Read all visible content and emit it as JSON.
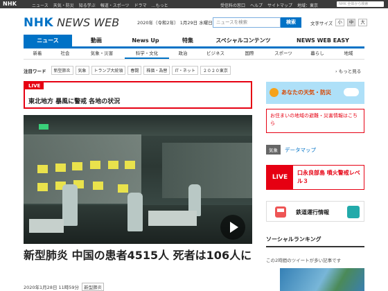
{
  "topbar": {
    "logo": "NHK",
    "nav": [
      "ニュース",
      "天気・防災",
      "知る学ぶ",
      "報道・スポーツ",
      "ドラマ",
      "…もっと"
    ],
    "right": [
      "受信料の窓口",
      "ヘルプ",
      "サイトマップ",
      "地域：東京"
    ],
    "search_placeholder": "NHK 全体から検索"
  },
  "header": {
    "brand_nhk": "NHK",
    "brand_news": "NEWS WEB",
    "date": "2020年（令和2年） 1月29日 水曜日",
    "search_placeholder": "ニュースを検索",
    "search_button": "検索",
    "font_size_label": "文字サイズ",
    "font_sizes": [
      "小",
      "中",
      "大"
    ],
    "font_size_selected": "中"
  },
  "main_nav": [
    "ニュース",
    "動画",
    "News Up",
    "特集",
    "スペシャルコンテンツ",
    "NEWS WEB EASY"
  ],
  "main_nav_active": "ニュース",
  "sub_nav": [
    "新着",
    "社会",
    "気象・災害",
    "科学・文化",
    "政治",
    "ビジネス",
    "国際",
    "スポーツ",
    "暮らし",
    "地域"
  ],
  "sub_nav_active": "科学・文化",
  "keywords": {
    "label": "注目ワード",
    "tags": [
      "新型肺炎",
      "気象",
      "トランプ大統領",
      "春闘",
      "株価・為替",
      "IT・ネット",
      "２０２０東京"
    ],
    "more": "もっと見る"
  },
  "live": {
    "badge": "LIVE",
    "headline": "東北地方 暴風に警戒 各地の状況"
  },
  "article": {
    "headline": "新型肺炎 中国の患者4515人 死者は106人に",
    "date": "2020年1月28日 11時59分",
    "tag": "新型肺炎"
  },
  "sidebar": {
    "weather": "あなたの天気・防災",
    "evac": "お住まいの地域の避難・災害情報はこちら",
    "kisho_badge": "気象",
    "kisho_link": "データマップ",
    "warn_badge": "LIVE",
    "warn_text": "口永良部島 噴火警戒レベル３",
    "train": "鉄道運行情報",
    "social_title": "ソーシャルランキング",
    "social_sub": "この2時間のツイートが多い記事です"
  },
  "colors": {
    "brand_blue": "#0072c6",
    "alert_red": "#e60012"
  }
}
